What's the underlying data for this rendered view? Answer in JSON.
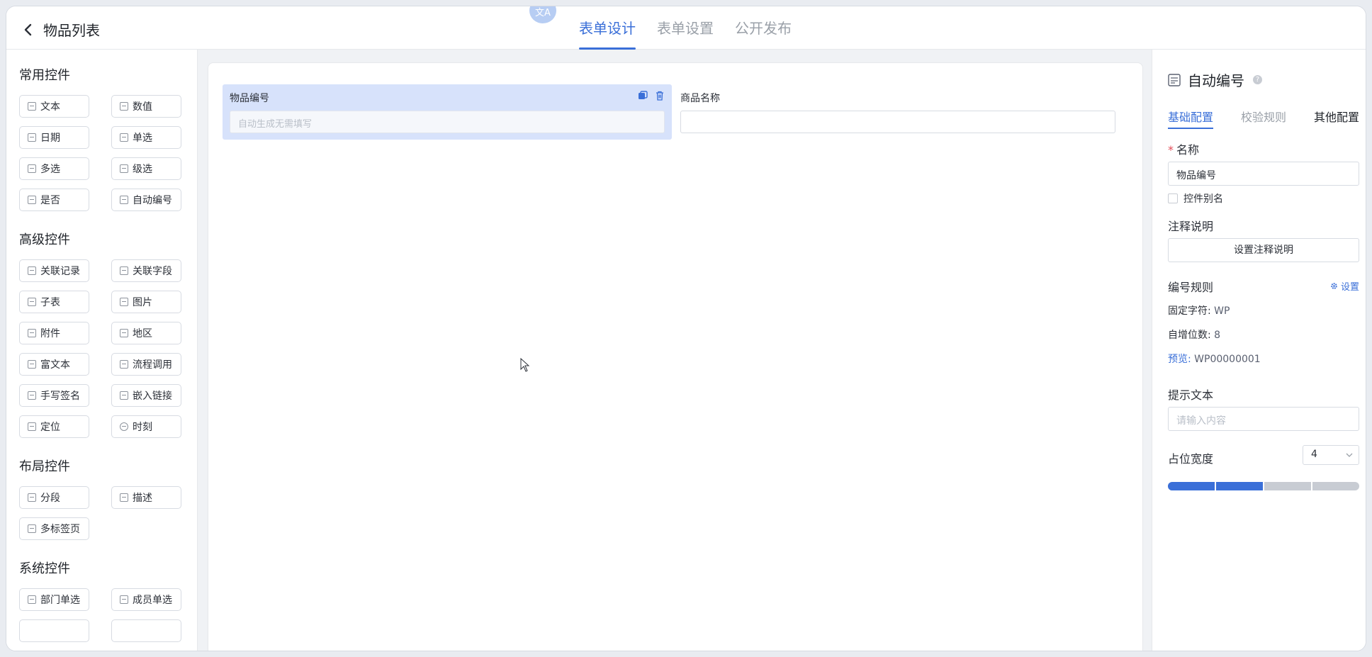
{
  "header": {
    "back_label": "物品列表",
    "translate_badge": "文A",
    "tabs": [
      "表单设计",
      "表单设置",
      "公开发布"
    ],
    "active_tab": 0
  },
  "left_panel": {
    "groups": [
      {
        "title": "常用控件",
        "items": [
          "文本",
          "数值",
          "日期",
          "单选",
          "多选",
          "级选",
          "是否",
          "自动编号"
        ]
      },
      {
        "title": "高级控件",
        "items": [
          "关联记录",
          "关联字段",
          "子表",
          "图片",
          "附件",
          "地区",
          "富文本",
          "流程调用",
          "手写签名",
          "嵌入链接",
          "定位",
          "时刻"
        ]
      },
      {
        "title": "布局控件",
        "items": [
          "分段",
          "描述",
          "多标签页"
        ]
      },
      {
        "title": "系统控件",
        "items": [
          "部门单选",
          "成员单选"
        ]
      }
    ]
  },
  "canvas": {
    "field_a": {
      "label": "物品编号",
      "placeholder": "自动生成无需填写"
    },
    "field_b": {
      "label": "商品名称",
      "value": ""
    }
  },
  "right_panel": {
    "title": "自动编号",
    "tabs": [
      "基础配置",
      "校验规则",
      "其他配置"
    ],
    "name_label": "名称",
    "name_value": "物品编号",
    "alias_label": "控件别名",
    "note_label": "注释说明",
    "note_button": "设置注释说明",
    "rule_label": "编号规则",
    "rule_set_link": "设置",
    "rule_fixed_key": "固定字符:",
    "rule_fixed_val": "WP",
    "rule_digits_key": "自增位数:",
    "rule_digits_val": "8",
    "rule_preview_key": "预览:",
    "rule_preview_val": "WP00000001",
    "hint_label": "提示文本",
    "hint_placeholder": "请输入内容",
    "width_label": "占位宽度",
    "width_value": "4",
    "width_fraction": 0.5
  },
  "colors": {
    "accent": "#3a6fd8",
    "selected_field": "#d7e2fb"
  }
}
